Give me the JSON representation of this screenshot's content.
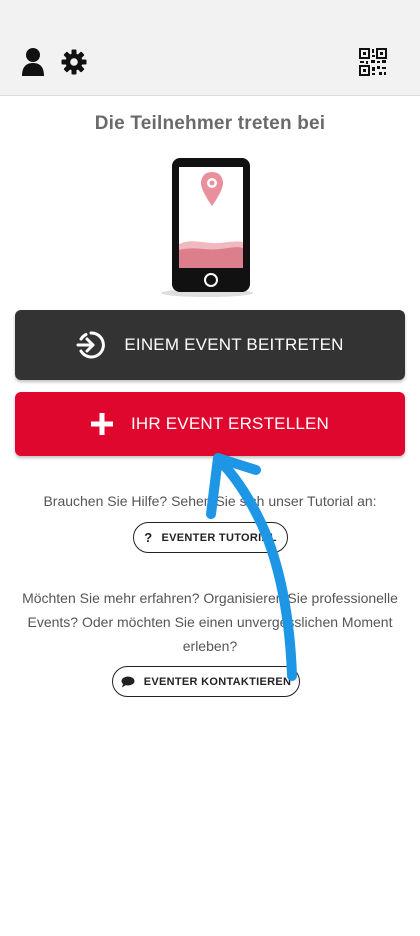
{
  "header": {
    "profile_icon": "user-icon",
    "settings_icon": "gear-icon",
    "qr_icon": "qr-code-icon"
  },
  "main": {
    "heading": "Die Teilnehmer treten bei",
    "join_button": {
      "label": "EINEM EVENT BEITRETEN",
      "icon": "sign-in-icon"
    },
    "create_button": {
      "label": "IHR EVENT ERSTELLEN",
      "icon": "plus-icon"
    },
    "help_text": "Brauchen Sie Hilfe? Sehen Sie sich unser Tutorial an:",
    "tutorial_button": {
      "label": "EVENTER TUTORIAL",
      "icon_text": "?"
    },
    "more_text": "Möchten Sie mehr erfahren? Organisieren Sie professionelle Events? Oder möchten Sie einen unvergesslichen Moment erleben?",
    "contact_button": {
      "label": "EVENTER KONTAKTIEREN",
      "icon": "chat-bubble-icon"
    }
  },
  "colors": {
    "join_bg": "#333333",
    "create_bg": "#e0072f",
    "annotation_arrow": "#1e96e6"
  }
}
